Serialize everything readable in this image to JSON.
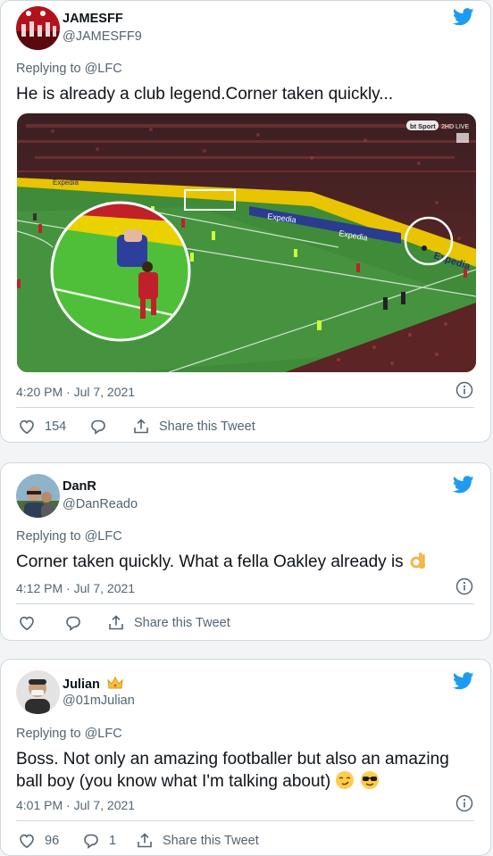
{
  "tweets": [
    {
      "name": "JAMESFF",
      "handle": "@JAMESFF9",
      "replying_prefix": "Replying to",
      "replying_to": "@LFC",
      "text": "He is already a club legend.Corner taken quickly...",
      "time": "4:20 PM · Jul 7, 2021",
      "likes": "154",
      "share_label": "Share this Tweet",
      "media": {
        "broadcaster": "bt Sport",
        "live": "2HD LIVE",
        "ad_text": "Expedia"
      }
    },
    {
      "name": "DanR",
      "handle": "@DanReado",
      "replying_prefix": "Replying to",
      "replying_to": "@LFC",
      "text": "Corner taken quickly. What a fella Oakley already is",
      "time": "4:12 PM · Jul 7, 2021",
      "share_label": "Share this Tweet"
    },
    {
      "name": "Julian",
      "handle": "@01mJulian",
      "replying_prefix": "Replying to",
      "replying_to": "@LFC",
      "text": "Boss. Not only an amazing footballer but also an amazing ball boy (you know what I'm talking about)",
      "time": "4:01 PM · Jul 7, 2021",
      "likes": "96",
      "replies": "1",
      "share_label": "Share this Tweet"
    }
  ],
  "colors": {
    "accent": "#1d9bf0",
    "text": "#0f1419",
    "muted": "#536471",
    "border": "#cfd9de"
  },
  "icons": [
    "twitter-bird-icon",
    "info-icon",
    "heart-icon",
    "reply-icon",
    "share-icon",
    "crown-emoji",
    "ok-hand-emoji",
    "smirk-emoji",
    "sunglasses-emoji"
  ]
}
